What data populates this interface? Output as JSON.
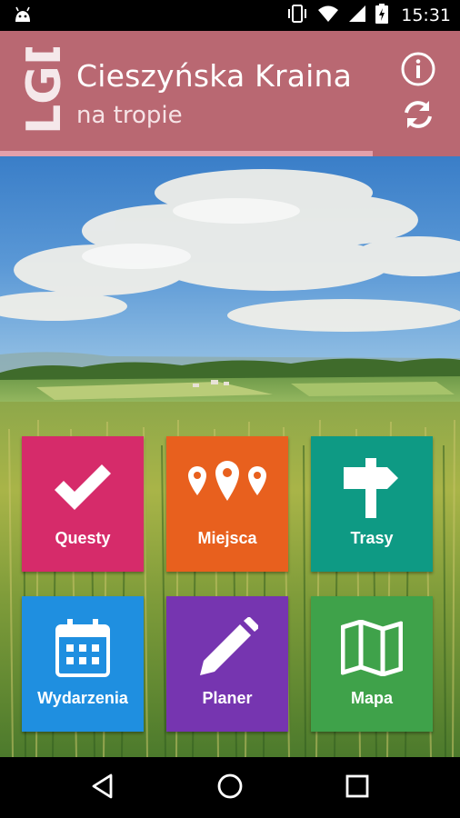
{
  "status_bar": {
    "time": "15:31",
    "icons": [
      "android-icon",
      "vibrate-icon",
      "wifi-icon",
      "signal-icon",
      "battery-charging-icon"
    ]
  },
  "header": {
    "logo_text": "LGD",
    "title": "Cieszyńska Kraina",
    "subtitle": "na tropie",
    "info_icon": "info-icon",
    "refresh_icon": "refresh-icon"
  },
  "progress": {
    "fraction": 0.81
  },
  "tiles": [
    {
      "label": "Questy",
      "icon": "checkmark-icon",
      "color": "#d62b6a"
    },
    {
      "label": "Miejsca",
      "icon": "map-pins-icon",
      "color": "#e8601e"
    },
    {
      "label": "Trasy",
      "icon": "signpost-icon",
      "color": "#0e9a84"
    },
    {
      "label": "Wydarzenia",
      "icon": "calendar-icon",
      "color": "#1f8fe0"
    },
    {
      "label": "Planer",
      "icon": "pencil-icon",
      "color": "#7635b0"
    },
    {
      "label": "Mapa",
      "icon": "map-icon",
      "color": "#3fa24a"
    }
  ],
  "nav_bar": {
    "back": "back-icon",
    "home": "home-icon",
    "recents": "recents-icon"
  },
  "colors": {
    "header": "#b96872",
    "progress": "#e2a0ab"
  }
}
